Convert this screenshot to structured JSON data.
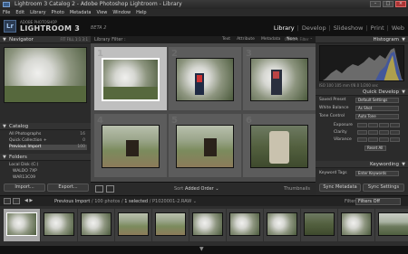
{
  "window": {
    "title": "Lightroom 3 Catalog 2 - Adobe Photoshop Lightroom - Library",
    "buttons": [
      "–",
      "□",
      "×"
    ]
  },
  "menu": [
    "File",
    "Edit",
    "Library",
    "Photo",
    "Metadata",
    "View",
    "Window",
    "Help"
  ],
  "identity": {
    "logo": "Lr",
    "brand_small": "ADOBE PHOTOSHOP",
    "brand_big": "LIGHTROOM 3",
    "beta": "BETA 2"
  },
  "modules": {
    "items": [
      "Library",
      "Develop",
      "Slideshow",
      "Print",
      "Web"
    ],
    "active": "Library",
    "separator": "|"
  },
  "left_panel": {
    "navigator": {
      "label": "Navigator",
      "extra": "FIT   FILL   1:1   3:1"
    },
    "catalog": {
      "label": "Catalog",
      "rows": [
        {
          "label": "All Photographs",
          "count": "16"
        },
        {
          "label": "Quick Collection +",
          "count": "0"
        },
        {
          "label": "Previous Import",
          "count": "100"
        }
      ]
    },
    "folders": {
      "label": "Folders",
      "rows": [
        "Local Disk (C:)",
        "WALDO 7XP",
        "WAR13C09"
      ]
    },
    "buttons": {
      "import": "Import...",
      "export": "Export..."
    }
  },
  "filter_bar": {
    "label": "Library Filter :",
    "options": [
      "Text",
      "Attribute",
      "Metadata",
      "None"
    ],
    "active": "None",
    "custom": "Custom Filter ⌃"
  },
  "grid": {
    "cells": [
      {
        "num": "1",
        "selected": true
      },
      {
        "num": "2",
        "selected": false
      },
      {
        "num": "3",
        "selected": false
      },
      {
        "num": "4",
        "selected": false
      },
      {
        "num": "5",
        "selected": false
      },
      {
        "num": "6",
        "selected": false
      }
    ]
  },
  "grid_toolbar": {
    "sort_label": "Sort :",
    "sort_value": "Added Order ⌄",
    "thumbnails_label": "Thumbnails"
  },
  "right_panel": {
    "histogram": {
      "label": "Histogram",
      "info": "ISO 100    105 mm    f/8.0    1/200 sec"
    },
    "quick_develop": {
      "label": "Quick Develop",
      "saved_preset": {
        "label": "Saved Preset",
        "value": "Default Settings"
      },
      "white_balance": {
        "label": "White Balance",
        "value": "As Shot"
      },
      "tone_control": {
        "label": "Tone Control",
        "value": "Auto Tone"
      },
      "exposure": "Exposure",
      "clarity": "Clarity",
      "vibrance": "Vibrance",
      "reset": "Reset All"
    },
    "keywording": {
      "label": "Keywording",
      "tags_label": "Keyword Tags",
      "tags_value": "Enter Keywords"
    },
    "buttons": {
      "sync_metadata": "Sync Metadata",
      "sync_settings": "Sync Settings"
    }
  },
  "filmstrip_bar": {
    "arrows": "◀ ▶",
    "source": "Previous Import",
    "count": "/ 100 photos /",
    "selected": "1 selected",
    "file": "/ P1020001-2.RAW ⌄",
    "filter_label": "Filter :",
    "filter_value": "Filters Off"
  },
  "filmstrip": {
    "thumbs": [
      "1",
      "2",
      "3",
      "4",
      "5",
      "6",
      "7",
      "8",
      "9",
      "10",
      "11"
    ],
    "selected_index": 0
  },
  "colors": {
    "panel": "#2b2b2b",
    "grid_bg": "#4a4a4a",
    "selected_cell": "#bfbfbf",
    "active_module": "#ffffff"
  }
}
